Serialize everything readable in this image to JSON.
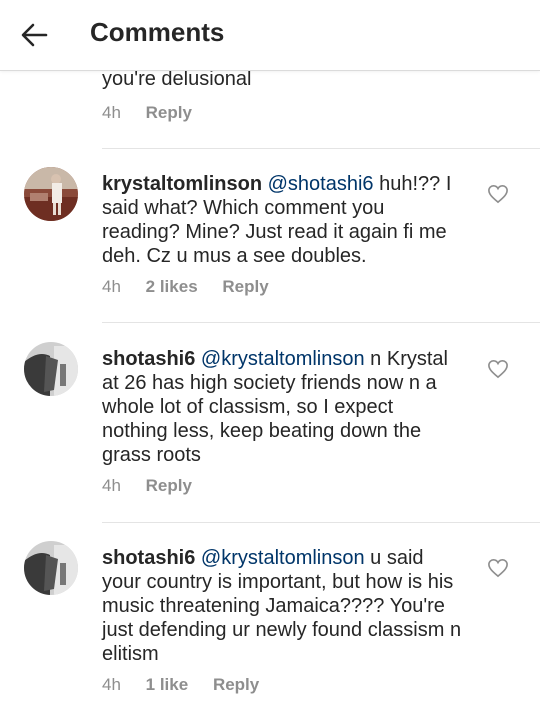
{
  "header": {
    "title": "Comments"
  },
  "partial_comment": {
    "text": "you're delusional",
    "time": "4h",
    "reply_label": "Reply"
  },
  "comments": [
    {
      "username": "krystaltomlinson",
      "mention": "@shotashi6",
      "text": "huh!?? I said what? Which comment you reading? Mine? Just read it again fi me deh. Cz u mus a see doubles.",
      "time": "4h",
      "likes": "2 likes",
      "reply_label": "Reply"
    },
    {
      "username": "shotashi6",
      "mention": "@krystaltomlinson",
      "text": "n Krystal at 26 has high society friends now n a whole lot of classism, so I expect nothing less, keep beating down the grass roots",
      "time": "4h",
      "reply_label": "Reply"
    },
    {
      "username": "shotashi6",
      "mention": "@krystaltomlinson",
      "text": "u said your country is important, but how is his music threatening Jamaica???? You're just defending ur newly found classism n elitism",
      "time": "4h",
      "likes": "1 like",
      "reply_label": "Reply"
    }
  ]
}
